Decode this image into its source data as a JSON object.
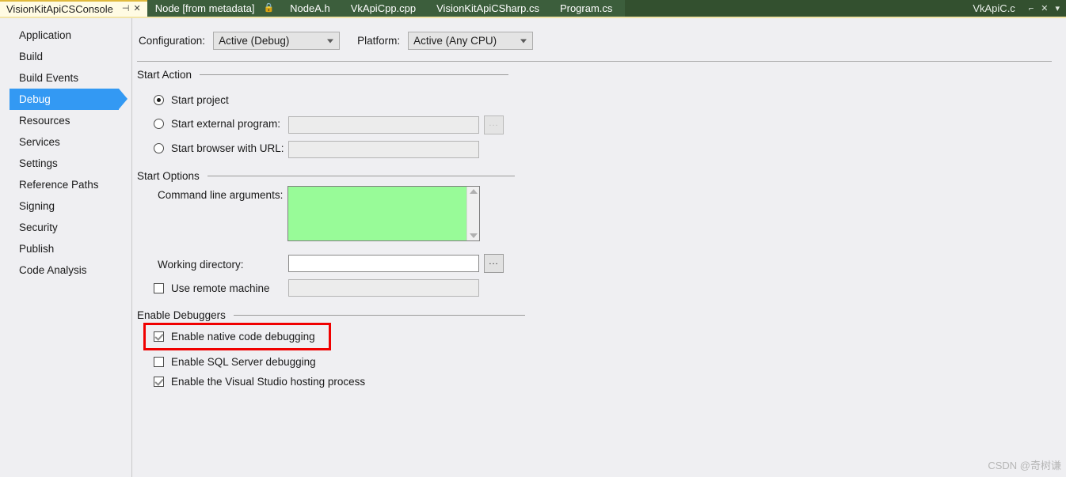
{
  "tabs": {
    "active": {
      "label": "VisionKitApiCSConsole",
      "pin_icon": "pin-icon",
      "close_icon": "close-icon"
    },
    "inactive": [
      {
        "label": "Node [from metadata]",
        "icon": "lock-icon"
      },
      {
        "label": "NodeA.h",
        "icon": ""
      },
      {
        "label": "VkApiCpp.cpp",
        "icon": ""
      },
      {
        "label": "VisionKitApiCSharp.cs",
        "icon": ""
      },
      {
        "label": "Program.cs",
        "icon": ""
      }
    ],
    "right": {
      "label": "VkApiC.c",
      "pin_icon": "pin-icon",
      "close_icon": "close-icon",
      "dropdown_icon": "chevron-down-icon"
    }
  },
  "sidebar": {
    "items": [
      {
        "label": "Application",
        "selected": false
      },
      {
        "label": "Build",
        "selected": false
      },
      {
        "label": "Build Events",
        "selected": false
      },
      {
        "label": "Debug",
        "selected": true
      },
      {
        "label": "Resources",
        "selected": false
      },
      {
        "label": "Services",
        "selected": false
      },
      {
        "label": "Settings",
        "selected": false
      },
      {
        "label": "Reference Paths",
        "selected": false
      },
      {
        "label": "Signing",
        "selected": false
      },
      {
        "label": "Security",
        "selected": false
      },
      {
        "label": "Publish",
        "selected": false
      },
      {
        "label": "Code Analysis",
        "selected": false
      }
    ]
  },
  "toolbar": {
    "configuration_label": "Configuration:",
    "configuration_value": "Active (Debug)",
    "platform_label": "Platform:",
    "platform_value": "Active (Any CPU)"
  },
  "start_action": {
    "title": "Start Action",
    "start_project_label": "Start project",
    "start_project_checked": true,
    "start_external_label": "Start external program:",
    "start_external_checked": false,
    "start_external_value": "",
    "start_browser_label": "Start browser with URL:",
    "start_browser_checked": false,
    "start_browser_value": "",
    "browse_label": "..."
  },
  "start_options": {
    "title": "Start Options",
    "cmd_args_label": "Command line arguments:",
    "cmd_args_value": "",
    "working_dir_label": "Working directory:",
    "working_dir_value": "",
    "browse_label": "...",
    "use_remote_label": "Use remote machine",
    "use_remote_checked": false,
    "remote_value": ""
  },
  "enable_debuggers": {
    "title": "Enable Debuggers",
    "items": [
      {
        "label": "Enable native code debugging",
        "checked": true,
        "highlighted": true
      },
      {
        "label": "Enable SQL Server debugging",
        "checked": false,
        "highlighted": false
      },
      {
        "label": "Enable the Visual Studio hosting process",
        "checked": true,
        "highlighted": false
      }
    ]
  },
  "watermark": {
    "text": "CSDN @奇树谦"
  },
  "colors": {
    "tabbar_bg": "#3c5e3c",
    "tabbar_filler": "#33502f",
    "active_tab_bg": "#fffbe3",
    "active_tab_border": "#e0b93c",
    "tabbar_underline": "#f2e4a8",
    "selection_blue": "#3399f3",
    "highlight_green": "#98fb98",
    "annotation_red": "#f00000",
    "panel_bg": "#efeff2"
  }
}
